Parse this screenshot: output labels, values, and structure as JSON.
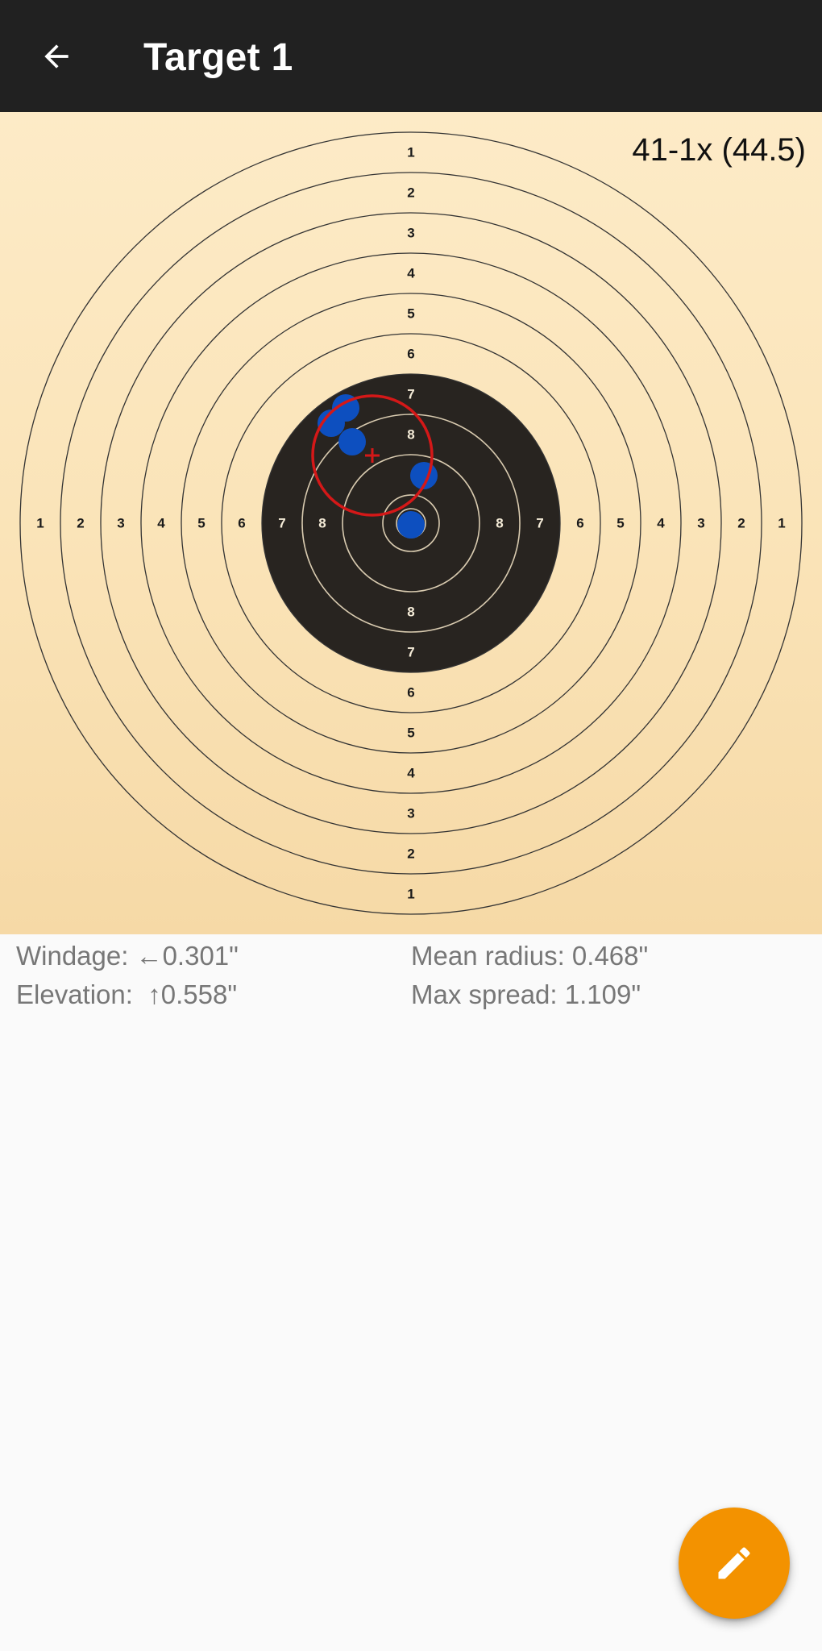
{
  "app_bar": {
    "title": "Target 1",
    "back_icon": "arrow-back-icon"
  },
  "target": {
    "score": "41-1x (44.5)",
    "ring_labels": [
      "1",
      "2",
      "3",
      "4",
      "5",
      "6",
      "7",
      "8"
    ],
    "colors": {
      "paper": "#fde9c4",
      "black_area": "#282420",
      "shot": "#0d4fbf",
      "group_circle": "#d41818",
      "ring_line": "#333333",
      "inner_ring_line": "#d9cbb0"
    },
    "shots": [
      {
        "label": "shot-1"
      },
      {
        "label": "shot-2"
      },
      {
        "label": "shot-3"
      },
      {
        "label": "shot-4"
      },
      {
        "label": "shot-5"
      }
    ]
  },
  "stats": {
    "windage": "Windage: ←0.301\"",
    "elevation": "Elevation:  ↑0.558\"",
    "mean_radius": "Mean radius: 0.468\"",
    "max_spread": "Max spread: 1.109\""
  },
  "fab": {
    "icon": "edit-pencil-icon"
  }
}
